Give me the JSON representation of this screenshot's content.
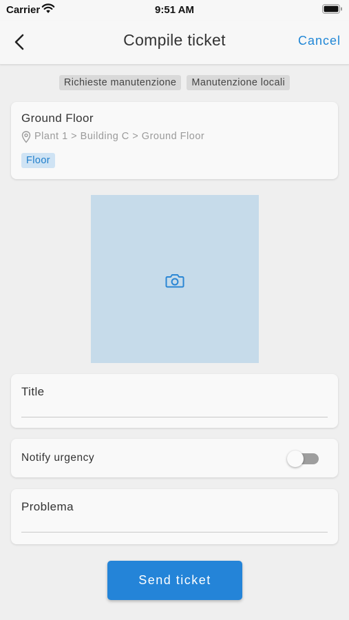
{
  "status_bar": {
    "carrier": "Carrier",
    "time": "9:51 AM"
  },
  "nav": {
    "title": "Compile ticket",
    "cancel_label": "Cancel"
  },
  "chips": [
    "Richieste manutenzione",
    "Manutenzione locali"
  ],
  "location": {
    "name": "Ground Floor",
    "path": "Plant 1 > Building C > Ground Floor",
    "type_tag": "Floor"
  },
  "photo": {
    "icon": "camera-icon"
  },
  "form": {
    "title_label": "Title",
    "title_value": "",
    "notify_label": "Notify urgency",
    "notify_on": false,
    "problem_label": "Problema",
    "problem_value": ""
  },
  "actions": {
    "send_label": "Send ticket"
  },
  "colors": {
    "accent": "#2484d8",
    "tag_bg": "#cfe3f4",
    "photo_bg": "#c6dbea"
  }
}
